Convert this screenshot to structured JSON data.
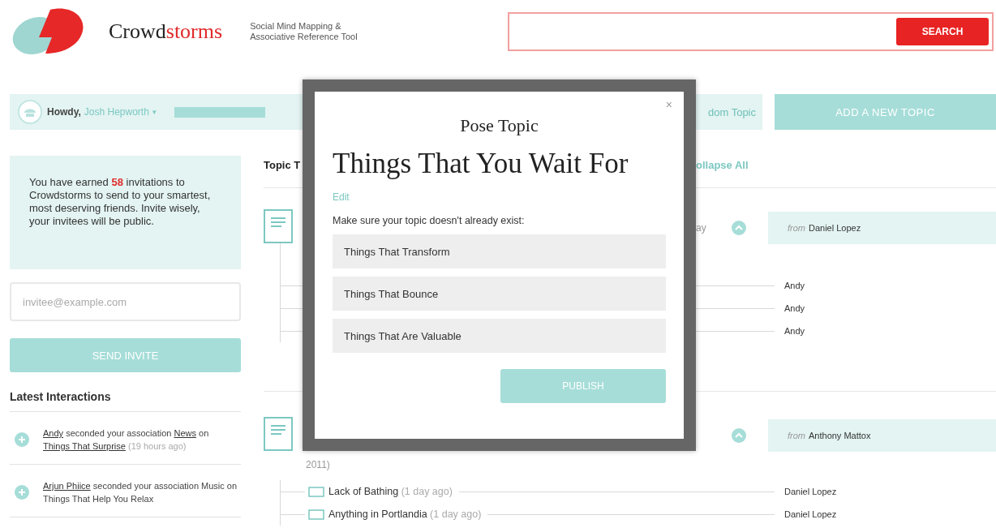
{
  "header": {
    "brand_dark": "Crowd",
    "brand_accent": "storms",
    "tagline": [
      "Social Mind Mapping &",
      "Associative Reference Tool"
    ],
    "search": {
      "button": "SEARCH"
    }
  },
  "user_bar": {
    "greeting": "Howdy,",
    "user_name": "Josh Hepworth",
    "caret": "▾",
    "random_topic_fragment": "dom Topic",
    "add_topic_button": "ADD A NEW TOPIC"
  },
  "sidebar": {
    "invite_text": "You have earned **58** invitations to Crowdstorms to send to your smartest, most deserving friends. Invite wisely, your invitees will be public.",
    "email_placeholder": "invitee@example.com",
    "send_button": "SEND INVITE",
    "latest_heading": "Latest Interactions",
    "interactions": [
      {
        "parts": [
          {
            "kind": "link",
            "text": "Andy"
          },
          {
            "kind": "plain",
            "text": " seconded your association "
          },
          {
            "kind": "link",
            "text": "News"
          },
          {
            "kind": "plain",
            "text": " on "
          },
          {
            "kind": "link",
            "text": "Things That Surprise"
          },
          {
            "kind": "time",
            "text": " (19 hours ago)"
          }
        ]
      },
      {
        "parts": [
          {
            "kind": "link",
            "text": "Arjun Phiice"
          },
          {
            "kind": "plain",
            "text": " seconded your association Music on Things That Help You Relax"
          }
        ]
      }
    ]
  },
  "main": {
    "heading_fragment": "Topic T",
    "collapse_fragment": "ollapse All",
    "topics": [
      {
        "date_fragment": "ay",
        "from_label": "from",
        "author": "Daniel Lopez",
        "children": [
          {
            "author": "Andy"
          },
          {
            "author": "Andy"
          },
          {
            "author": "Andy"
          }
        ]
      },
      {
        "date_continuation": "2011)",
        "from_label": "from",
        "author": "Anthony Mattox",
        "children": [
          {
            "title": "Lack of Bathing",
            "time": "(1 day ago)",
            "author": "Daniel Lopez"
          },
          {
            "title": "Anything in Portlandia",
            "time": "(1 day ago)",
            "author": "Daniel Lopez"
          }
        ]
      }
    ]
  },
  "dialog": {
    "close": "×",
    "heading": "Pose Topic",
    "title": "Things That You Wait For",
    "edit_link": "Edit",
    "prompt": "Make sure your topic doesn't already exist:",
    "suggestions": [
      "Things That Transform",
      "Things That Bounce",
      "Things That Are Valuable"
    ],
    "publish_button": "PUBLISH"
  }
}
